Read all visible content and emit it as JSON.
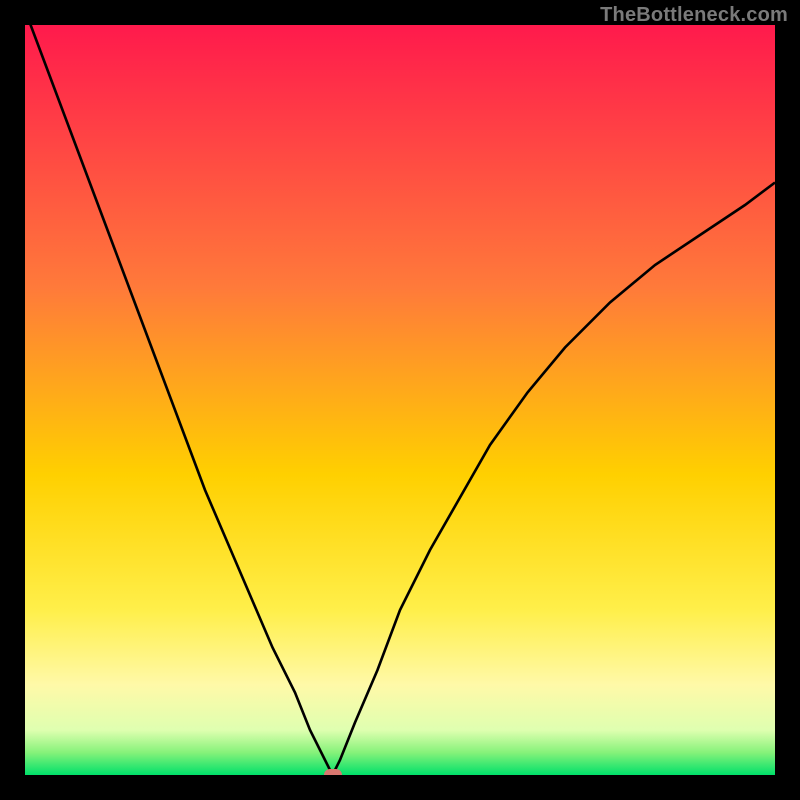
{
  "watermark": "TheBottleneck.com",
  "chart_data": {
    "type": "line",
    "title": "",
    "xlabel": "",
    "ylabel": "",
    "xlim": [
      0,
      100
    ],
    "ylim": [
      0,
      100
    ],
    "background_gradient_stops": [
      {
        "offset": 0,
        "color": "#ff1a4c"
      },
      {
        "offset": 35,
        "color": "#ff7a3a"
      },
      {
        "offset": 60,
        "color": "#ffd000"
      },
      {
        "offset": 78,
        "color": "#ffef4a"
      },
      {
        "offset": 88,
        "color": "#fff9a8"
      },
      {
        "offset": 94,
        "color": "#dfffb0"
      },
      {
        "offset": 97,
        "color": "#86f27a"
      },
      {
        "offset": 100,
        "color": "#00e06a"
      }
    ],
    "series": [
      {
        "name": "bottleneck-curve",
        "x": [
          0,
          3,
          6,
          9,
          12,
          15,
          18,
          21,
          24,
          27,
          30,
          33,
          36,
          38,
          40,
          41,
          42,
          44,
          47,
          50,
          54,
          58,
          62,
          67,
          72,
          78,
          84,
          90,
          96,
          100
        ],
        "y": [
          102,
          94,
          86,
          78,
          70,
          62,
          54,
          46,
          38,
          31,
          24,
          17,
          11,
          6,
          2,
          0,
          2,
          7,
          14,
          22,
          30,
          37,
          44,
          51,
          57,
          63,
          68,
          72,
          76,
          79
        ]
      }
    ],
    "marker": {
      "x": 41,
      "y": 0,
      "name": "optimal-point"
    }
  }
}
